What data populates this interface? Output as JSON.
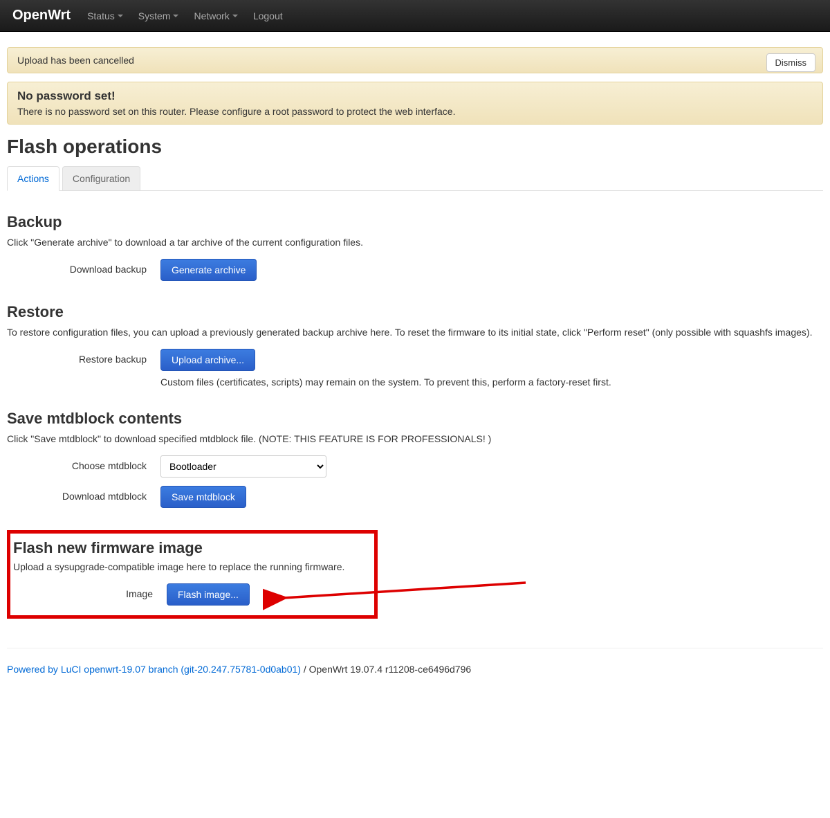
{
  "nav": {
    "brand": "OpenWrt",
    "items": [
      "Status",
      "System",
      "Network"
    ],
    "logout": "Logout"
  },
  "alert_upload": {
    "text": "Upload has been cancelled",
    "dismiss": "Dismiss"
  },
  "alert_password": {
    "title": "No password set!",
    "text": "There is no password set on this router. Please configure a root password to protect the web interface."
  },
  "page_title": "Flash operations",
  "tabs": {
    "actions": "Actions",
    "configuration": "Configuration"
  },
  "backup": {
    "heading": "Backup",
    "desc": "Click \"Generate archive\" to download a tar archive of the current configuration files.",
    "label": "Download backup",
    "button": "Generate archive"
  },
  "restore": {
    "heading": "Restore",
    "desc": "To restore configuration files, you can upload a previously generated backup archive here. To reset the firmware to its initial state, click \"Perform reset\" (only possible with squashfs images).",
    "label": "Restore backup",
    "button": "Upload archive...",
    "hint": "Custom files (certificates, scripts) may remain on the system. To prevent this, perform a factory-reset first."
  },
  "mtdblock": {
    "heading": "Save mtdblock contents",
    "desc": "Click \"Save mtdblock\" to download specified mtdblock file. (NOTE: THIS FEATURE IS FOR PROFESSIONALS! )",
    "choose_label": "Choose mtdblock",
    "choose_value": "Bootloader",
    "download_label": "Download mtdblock",
    "download_button": "Save mtdblock"
  },
  "flash": {
    "heading": "Flash new firmware image",
    "desc": "Upload a sysupgrade-compatible image here to replace the running firmware.",
    "label": "Image",
    "button": "Flash image..."
  },
  "footer": {
    "link": "Powered by LuCI openwrt-19.07 branch (git-20.247.75781-0d0ab01)",
    "rest": " / OpenWrt 19.07.4 r11208-ce6496d796"
  }
}
